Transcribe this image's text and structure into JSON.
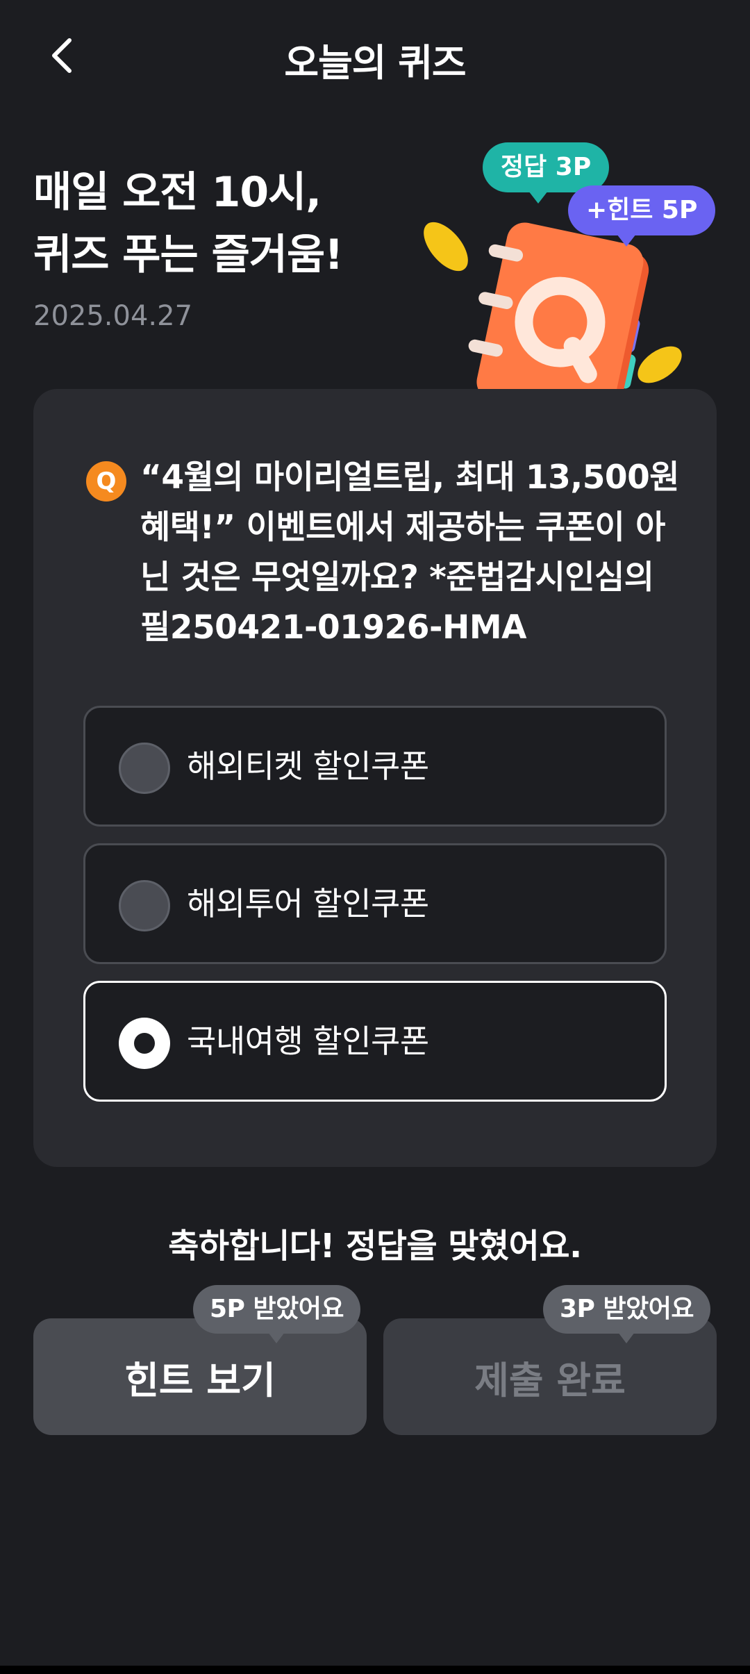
{
  "header": {
    "title": "오늘의 퀴즈",
    "back_icon": "chevron-left-icon"
  },
  "hero": {
    "title_line1": "매일 오전 10시,",
    "title_line2": "퀴즈 푸는 즐거움!",
    "date": "2025.04.27",
    "bubble_correct": "정답 3P",
    "bubble_hint": "+힌트 5P",
    "illustration_letter": "Q"
  },
  "quiz": {
    "badge": "Q",
    "question": "“4월의 마이리얼트립, 최대 13,500원 혜택!” 이벤트에서 제공하는 쿠폰이 아닌 것은 무엇일까요? *준법감시인심의필250421-01926-HMA",
    "options": [
      {
        "label": "해외티켓 할인쿠폰",
        "selected": false
      },
      {
        "label": "해외투어 할인쿠폰",
        "selected": false
      },
      {
        "label": "국내여행 할인쿠폰",
        "selected": true
      }
    ]
  },
  "result": {
    "message": "축하합니다! 정답을 맞혔어요.",
    "hint_button": "힌트 보기",
    "hint_tip": "5P 받았어요",
    "submit_button": "제출 완료",
    "submit_tip": "3P 받았어요"
  },
  "colors": {
    "background": "#1c1d21",
    "card": "#2a2b30",
    "accent_orange": "#f58a1f",
    "bubble_green": "#1fb4a6",
    "bubble_purple": "#6a63f2"
  }
}
